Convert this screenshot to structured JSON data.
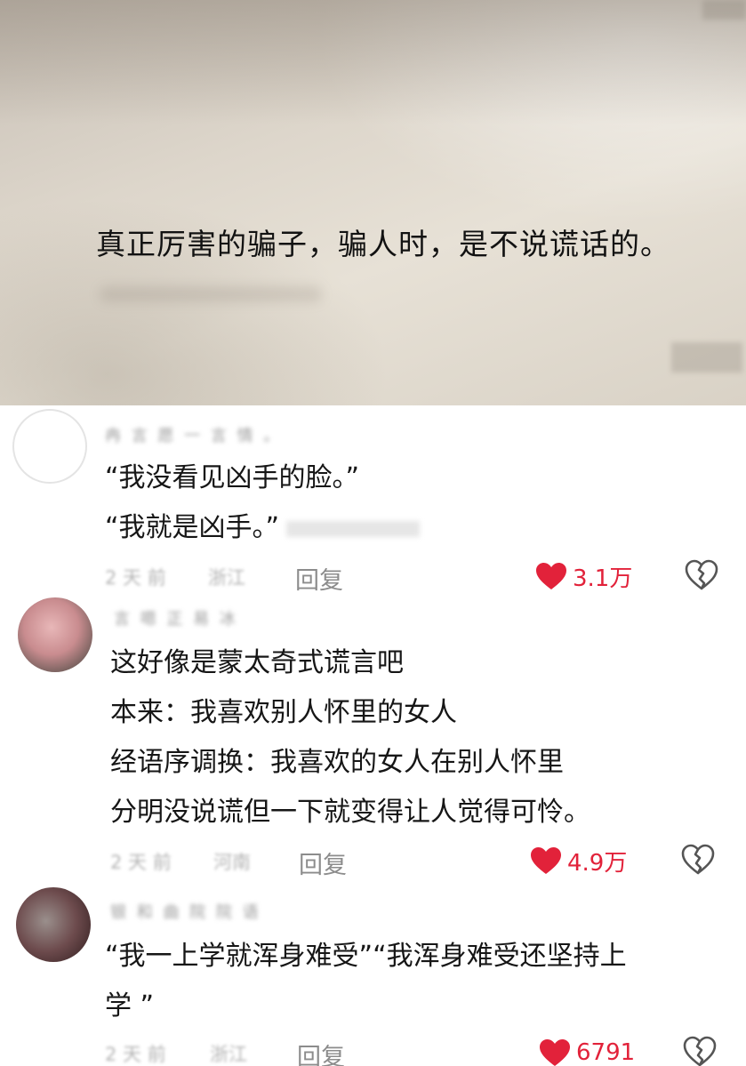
{
  "post": {
    "quote": "真正厉害的骗子，骗人时，是不说谎话的。"
  },
  "colors": {
    "like": "#e2223a",
    "text": "#161616",
    "meta": "#b3b3b3",
    "reply": "#8c8c8c"
  },
  "comments": [
    {
      "username": "冉 言 愿 一 言 情 。",
      "lines": [
        "“我没看见凶手的脸。”",
        "“我就是凶手。”"
      ],
      "time": "2 天 前",
      "location": "浙江",
      "reply_label": "回复",
      "likes": "3.1万"
    },
    {
      "username": "言 嗯 正 易 冰",
      "lines": [
        "这好像是蒙太奇式谎言吧",
        "本来：我喜欢别人怀里的女人",
        "经语序调换：我喜欢的女人在别人怀里",
        "分明没说谎但一下就变得让人觉得可怜。"
      ],
      "time": "2 天 前",
      "location": "河南",
      "reply_label": "回复",
      "likes": "4.9万"
    },
    {
      "username": "银 和 曲 院 院 语",
      "lines": [
        "“我一上学就浑身难受”“我浑身难受还坚持上",
        "学 ”"
      ],
      "time": "2 天 前",
      "location": "浙江",
      "reply_label": "回复",
      "likes": "6791"
    }
  ],
  "icons": {
    "like": "heart-icon",
    "dislike": "broken-heart-icon"
  }
}
